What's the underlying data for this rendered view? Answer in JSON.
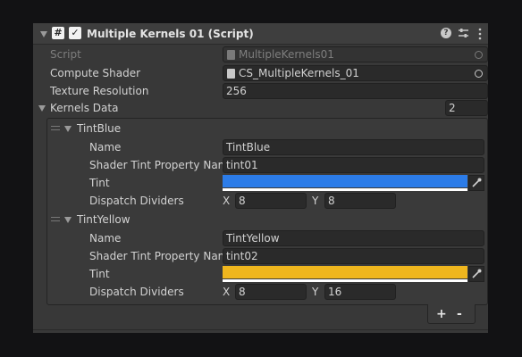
{
  "component": {
    "title": "Multiple Kernels 01 (Script)",
    "script_icon": "#",
    "enabled": true
  },
  "header_icons": [
    "help-icon",
    "preset-icon",
    "more-icon"
  ],
  "rows": {
    "script": {
      "label": "Script",
      "value": "MultipleKernels01"
    },
    "compute_shader": {
      "label": "Compute Shader",
      "value": "CS_MultipleKernels_01"
    },
    "texture_resolution": {
      "label": "Texture Resolution",
      "value": "256"
    },
    "kernels_data": {
      "label": "Kernels Data",
      "size": "2"
    }
  },
  "kernels": [
    {
      "header": "TintBlue",
      "name_label": "Name",
      "name_value": "TintBlue",
      "prop_label": "Shader Tint Property Nam",
      "prop_value": "tint01",
      "tint_label": "Tint",
      "tint_color": "#2c7ce8",
      "dispatch_label": "Dispatch Dividers",
      "x_label": "X",
      "x_value": "8",
      "y_label": "Y",
      "y_value": "8"
    },
    {
      "header": "TintYellow",
      "name_label": "Name",
      "name_value": "TintYellow",
      "prop_label": "Shader Tint Property Nam",
      "prop_value": "tint02",
      "tint_label": "Tint",
      "tint_color": "#efb61e",
      "dispatch_label": "Dispatch Dividers",
      "x_label": "X",
      "x_value": "8",
      "y_label": "Y",
      "y_value": "16"
    }
  ],
  "footer": {
    "add": "+",
    "remove": "-"
  }
}
